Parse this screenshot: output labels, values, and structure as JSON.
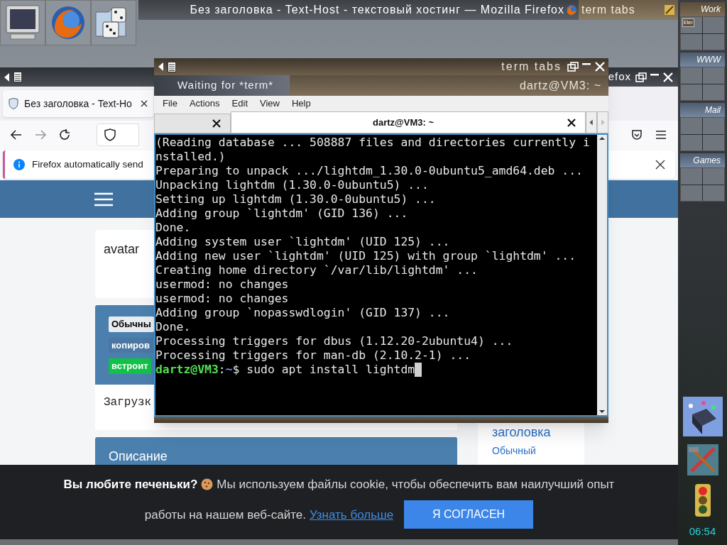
{
  "taskbar": {
    "title": "Без заголовка - Text-Host - текстовый хостинг — Mozilla Firefox",
    "other": "term tabs"
  },
  "firefox": {
    "title": "efox",
    "tab": {
      "title": "Без заголовка - Text-Ho"
    },
    "notification": "Firefox automatically send",
    "page": {
      "avatar": "avatar",
      "badges": [
        {
          "text": "Обычны",
          "color": "#e9ecef"
        },
        {
          "text": "копиров",
          "color": "#4a77a3"
        },
        {
          "text": "встроит",
          "color": "#12c148"
        }
      ],
      "loading": "Загрузк",
      "section": "Описание",
      "side_link": "заголовка",
      "side_item": "Обычный"
    },
    "cookie": {
      "title": "Вы любите печеньки?",
      "text": "Мы используем файлы cookie, чтобы обеспечить вам наилучший опыт",
      "text_2": "работы на нашем веб-сайте.",
      "link": "Узнать больше",
      "button": "Я СОГЛАСЕН"
    }
  },
  "terminal": {
    "title": "term tabs",
    "status": "Waiting for *term*",
    "host": "dartz@VM3: ~",
    "menu": [
      "File",
      "Actions",
      "Edit",
      "View",
      "Help"
    ],
    "tabs": [
      {
        "selected": false
      },
      {
        "label": "dartz@VM3: ~",
        "selected": true
      }
    ],
    "lines": [
      "(Reading database ... 508887 files and directories currently i",
      "nstalled.)",
      "Preparing to unpack .../lightdm_1.30.0-0ubuntu5_amd64.deb ...",
      "Unpacking lightdm (1.30.0-0ubuntu5) ...",
      "Setting up lightdm (1.30.0-0ubuntu5) ...",
      "Adding group `lightdm' (GID 136) ...",
      "Done.",
      "Adding system user `lightdm' (UID 125) ...",
      "Adding new user `lightdm' (UID 125) with group `lightdm' ...",
      "Creating home directory `/var/lib/lightdm' ...",
      "usermod: no changes",
      "usermod: no changes",
      "Adding group `nopasswdlogin' (GID 137) ...",
      "Done.",
      "Processing triggers for dbus (1.12.20-2ubuntu4) ...",
      "Processing triggers for man-db (2.10.2-1) ..."
    ],
    "prompt": {
      "user": "dartz@VM3",
      "sep": ":",
      "path": "~",
      "command": "$ sudo apt install lightdm"
    }
  },
  "dock": {
    "desks": [
      {
        "name": "Work",
        "windows": [
          "Eter"
        ]
      },
      {
        "name": "WWW"
      },
      {
        "name": "Mail"
      },
      {
        "name": "Games"
      }
    ],
    "clock": "06:54"
  }
}
